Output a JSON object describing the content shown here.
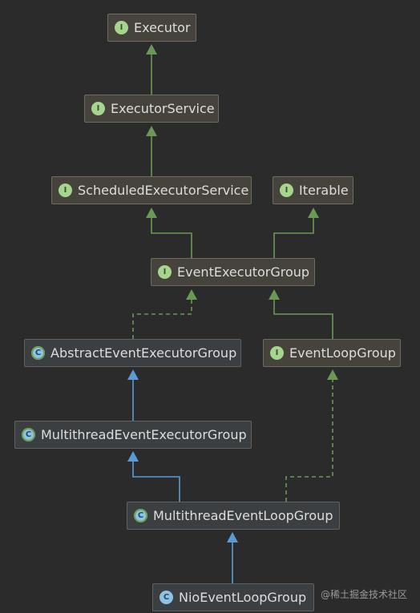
{
  "diagram": {
    "nodes": [
      {
        "id": "executor",
        "label": "Executor",
        "kind": "interface",
        "badge": "I"
      },
      {
        "id": "executorService",
        "label": "ExecutorService",
        "kind": "interface",
        "badge": "I"
      },
      {
        "id": "scheduledExecutorService",
        "label": "ScheduledExecutorService",
        "kind": "interface",
        "badge": "I"
      },
      {
        "id": "iterable",
        "label": "Iterable",
        "kind": "interface",
        "badge": "I"
      },
      {
        "id": "eventExecutorGroup",
        "label": "EventExecutorGroup",
        "kind": "interface",
        "badge": "I"
      },
      {
        "id": "abstractEventExecutorGroup",
        "label": "AbstractEventExecutorGroup",
        "kind": "abstract-class",
        "badge": "C"
      },
      {
        "id": "eventLoopGroup",
        "label": "EventLoopGroup",
        "kind": "interface",
        "badge": "I"
      },
      {
        "id": "multithreadEventExecutorGroup",
        "label": "MultithreadEventExecutorGroup",
        "kind": "abstract-class",
        "badge": "C"
      },
      {
        "id": "multithreadEventLoopGroup",
        "label": "MultithreadEventLoopGroup",
        "kind": "abstract-class",
        "badge": "C"
      },
      {
        "id": "nioEventLoopGroup",
        "label": "NioEventLoopGroup",
        "kind": "class",
        "badge": "C"
      }
    ],
    "edges": [
      {
        "from": "executorService",
        "to": "executor",
        "type": "extends"
      },
      {
        "from": "scheduledExecutorService",
        "to": "executorService",
        "type": "extends"
      },
      {
        "from": "eventExecutorGroup",
        "to": "scheduledExecutorService",
        "type": "extends"
      },
      {
        "from": "eventExecutorGroup",
        "to": "iterable",
        "type": "extends"
      },
      {
        "from": "abstractEventExecutorGroup",
        "to": "eventExecutorGroup",
        "type": "implements"
      },
      {
        "from": "eventLoopGroup",
        "to": "eventExecutorGroup",
        "type": "extends"
      },
      {
        "from": "multithreadEventExecutorGroup",
        "to": "abstractEventExecutorGroup",
        "type": "class-extends"
      },
      {
        "from": "multithreadEventLoopGroup",
        "to": "multithreadEventExecutorGroup",
        "type": "class-extends"
      },
      {
        "from": "multithreadEventLoopGroup",
        "to": "eventLoopGroup",
        "type": "implements"
      },
      {
        "from": "nioEventLoopGroup",
        "to": "multithreadEventLoopGroup",
        "type": "class-extends"
      }
    ],
    "colors": {
      "interface_edge": "#6a9955",
      "class_edge": "#5b9bd5"
    }
  },
  "watermark": "@稀土掘金技术社区"
}
